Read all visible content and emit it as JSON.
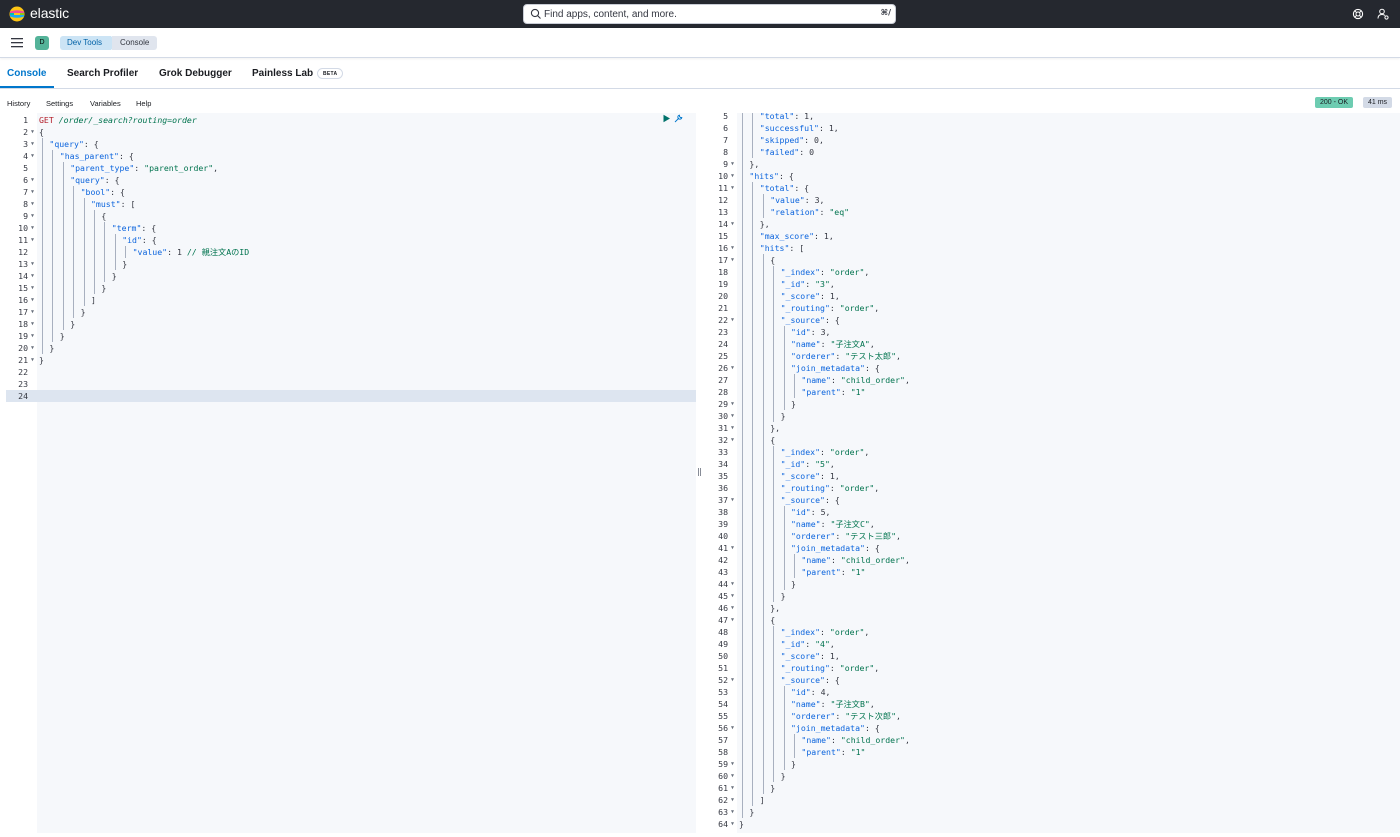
{
  "header": {
    "brand": "elastic",
    "search_placeholder": "Find apps, content, and more.",
    "search_shortcut": "⌘/"
  },
  "breadcrumbs": {
    "space_initial": "D",
    "items": [
      "Dev Tools",
      "Console"
    ]
  },
  "tabs": {
    "items": [
      {
        "label": "Console",
        "active": true
      },
      {
        "label": "Search Profiler",
        "active": false
      },
      {
        "label": "Grok Debugger",
        "active": false
      },
      {
        "label": "Painless Lab",
        "active": false
      }
    ],
    "beta_label": "BETA"
  },
  "toolbar": {
    "items": [
      "History",
      "Settings",
      "Variables",
      "Help"
    ],
    "status": "200 - OK",
    "duration": "41 ms"
  },
  "request_editor": {
    "active_line": 24,
    "lines": [
      {
        "n": "1",
        "fold": false,
        "indent": 0,
        "text": "GET /order/_search?routing=order"
      },
      {
        "n": "2",
        "fold": true,
        "indent": 0,
        "text": "{"
      },
      {
        "n": "3",
        "fold": true,
        "indent": 1,
        "text": "\"query\": {"
      },
      {
        "n": "4",
        "fold": true,
        "indent": 2,
        "text": "\"has_parent\": {"
      },
      {
        "n": "5",
        "fold": false,
        "indent": 3,
        "text": "\"parent_type\": \"parent_order\","
      },
      {
        "n": "6",
        "fold": true,
        "indent": 3,
        "text": "\"query\": {"
      },
      {
        "n": "7",
        "fold": true,
        "indent": 4,
        "text": "\"bool\": {"
      },
      {
        "n": "8",
        "fold": true,
        "indent": 5,
        "text": "\"must\": ["
      },
      {
        "n": "9",
        "fold": true,
        "indent": 6,
        "text": "{"
      },
      {
        "n": "10",
        "fold": true,
        "indent": 7,
        "text": "\"term\": {"
      },
      {
        "n": "11",
        "fold": true,
        "indent": 8,
        "text": "\"id\": {"
      },
      {
        "n": "12",
        "fold": false,
        "indent": 9,
        "text": "\"value\": 1 // 親注文AのID"
      },
      {
        "n": "13",
        "fold": true,
        "indent": 8,
        "text": "}"
      },
      {
        "n": "14",
        "fold": true,
        "indent": 7,
        "text": "}"
      },
      {
        "n": "15",
        "fold": true,
        "indent": 6,
        "text": "}"
      },
      {
        "n": "16",
        "fold": true,
        "indent": 5,
        "text": "]"
      },
      {
        "n": "17",
        "fold": true,
        "indent": 4,
        "text": "}"
      },
      {
        "n": "18",
        "fold": true,
        "indent": 3,
        "text": "}"
      },
      {
        "n": "19",
        "fold": true,
        "indent": 2,
        "text": "}"
      },
      {
        "n": "20",
        "fold": true,
        "indent": 1,
        "text": "}"
      },
      {
        "n": "21",
        "fold": true,
        "indent": 0,
        "text": "}"
      },
      {
        "n": "22",
        "fold": false,
        "indent": 0,
        "text": ""
      },
      {
        "n": "23",
        "fold": false,
        "indent": 0,
        "text": ""
      },
      {
        "n": "24",
        "fold": false,
        "indent": 0,
        "text": ""
      }
    ]
  },
  "response_editor": {
    "lines": [
      {
        "n": "5",
        "fold": false,
        "indent": 2,
        "text": "\"total\": 1,"
      },
      {
        "n": "6",
        "fold": false,
        "indent": 2,
        "text": "\"successful\": 1,"
      },
      {
        "n": "7",
        "fold": false,
        "indent": 2,
        "text": "\"skipped\": 0,"
      },
      {
        "n": "8",
        "fold": false,
        "indent": 2,
        "text": "\"failed\": 0"
      },
      {
        "n": "9",
        "fold": true,
        "indent": 1,
        "text": "},"
      },
      {
        "n": "10",
        "fold": true,
        "indent": 1,
        "text": "\"hits\": {"
      },
      {
        "n": "11",
        "fold": true,
        "indent": 2,
        "text": "\"total\": {"
      },
      {
        "n": "12",
        "fold": false,
        "indent": 3,
        "text": "\"value\": 3,"
      },
      {
        "n": "13",
        "fold": false,
        "indent": 3,
        "text": "\"relation\": \"eq\""
      },
      {
        "n": "14",
        "fold": true,
        "indent": 2,
        "text": "},"
      },
      {
        "n": "15",
        "fold": false,
        "indent": 2,
        "text": "\"max_score\": 1,"
      },
      {
        "n": "16",
        "fold": true,
        "indent": 2,
        "text": "\"hits\": ["
      },
      {
        "n": "17",
        "fold": true,
        "indent": 3,
        "text": "{"
      },
      {
        "n": "18",
        "fold": false,
        "indent": 4,
        "text": "\"_index\": \"order\","
      },
      {
        "n": "19",
        "fold": false,
        "indent": 4,
        "text": "\"_id\": \"3\","
      },
      {
        "n": "20",
        "fold": false,
        "indent": 4,
        "text": "\"_score\": 1,"
      },
      {
        "n": "21",
        "fold": false,
        "indent": 4,
        "text": "\"_routing\": \"order\","
      },
      {
        "n": "22",
        "fold": true,
        "indent": 4,
        "text": "\"_source\": {"
      },
      {
        "n": "23",
        "fold": false,
        "indent": 5,
        "text": "\"id\": 3,"
      },
      {
        "n": "24",
        "fold": false,
        "indent": 5,
        "text": "\"name\": \"子注文A\","
      },
      {
        "n": "25",
        "fold": false,
        "indent": 5,
        "text": "\"orderer\": \"テスト太郎\","
      },
      {
        "n": "26",
        "fold": true,
        "indent": 5,
        "text": "\"join_metadata\": {"
      },
      {
        "n": "27",
        "fold": false,
        "indent": 6,
        "text": "\"name\": \"child_order\","
      },
      {
        "n": "28",
        "fold": false,
        "indent": 6,
        "text": "\"parent\": \"1\""
      },
      {
        "n": "29",
        "fold": true,
        "indent": 5,
        "text": "}"
      },
      {
        "n": "30",
        "fold": true,
        "indent": 4,
        "text": "}"
      },
      {
        "n": "31",
        "fold": true,
        "indent": 3,
        "text": "},"
      },
      {
        "n": "32",
        "fold": true,
        "indent": 3,
        "text": "{"
      },
      {
        "n": "33",
        "fold": false,
        "indent": 4,
        "text": "\"_index\": \"order\","
      },
      {
        "n": "34",
        "fold": false,
        "indent": 4,
        "text": "\"_id\": \"5\","
      },
      {
        "n": "35",
        "fold": false,
        "indent": 4,
        "text": "\"_score\": 1,"
      },
      {
        "n": "36",
        "fold": false,
        "indent": 4,
        "text": "\"_routing\": \"order\","
      },
      {
        "n": "37",
        "fold": true,
        "indent": 4,
        "text": "\"_source\": {"
      },
      {
        "n": "38",
        "fold": false,
        "indent": 5,
        "text": "\"id\": 5,"
      },
      {
        "n": "39",
        "fold": false,
        "indent": 5,
        "text": "\"name\": \"子注文C\","
      },
      {
        "n": "40",
        "fold": false,
        "indent": 5,
        "text": "\"orderer\": \"テスト三郎\","
      },
      {
        "n": "41",
        "fold": true,
        "indent": 5,
        "text": "\"join_metadata\": {"
      },
      {
        "n": "42",
        "fold": false,
        "indent": 6,
        "text": "\"name\": \"child_order\","
      },
      {
        "n": "43",
        "fold": false,
        "indent": 6,
        "text": "\"parent\": \"1\""
      },
      {
        "n": "44",
        "fold": true,
        "indent": 5,
        "text": "}"
      },
      {
        "n": "45",
        "fold": true,
        "indent": 4,
        "text": "}"
      },
      {
        "n": "46",
        "fold": true,
        "indent": 3,
        "text": "},"
      },
      {
        "n": "47",
        "fold": true,
        "indent": 3,
        "text": "{"
      },
      {
        "n": "48",
        "fold": false,
        "indent": 4,
        "text": "\"_index\": \"order\","
      },
      {
        "n": "49",
        "fold": false,
        "indent": 4,
        "text": "\"_id\": \"4\","
      },
      {
        "n": "50",
        "fold": false,
        "indent": 4,
        "text": "\"_score\": 1,"
      },
      {
        "n": "51",
        "fold": false,
        "indent": 4,
        "text": "\"_routing\": \"order\","
      },
      {
        "n": "52",
        "fold": true,
        "indent": 4,
        "text": "\"_source\": {"
      },
      {
        "n": "53",
        "fold": false,
        "indent": 5,
        "text": "\"id\": 4,"
      },
      {
        "n": "54",
        "fold": false,
        "indent": 5,
        "text": "\"name\": \"子注文B\","
      },
      {
        "n": "55",
        "fold": false,
        "indent": 5,
        "text": "\"orderer\": \"テスト次郎\","
      },
      {
        "n": "56",
        "fold": true,
        "indent": 5,
        "text": "\"join_metadata\": {"
      },
      {
        "n": "57",
        "fold": false,
        "indent": 6,
        "text": "\"name\": \"child_order\","
      },
      {
        "n": "58",
        "fold": false,
        "indent": 6,
        "text": "\"parent\": \"1\""
      },
      {
        "n": "59",
        "fold": true,
        "indent": 5,
        "text": "}"
      },
      {
        "n": "60",
        "fold": true,
        "indent": 4,
        "text": "}"
      },
      {
        "n": "61",
        "fold": true,
        "indent": 3,
        "text": "}"
      },
      {
        "n": "62",
        "fold": true,
        "indent": 2,
        "text": "]"
      },
      {
        "n": "63",
        "fold": true,
        "indent": 1,
        "text": "}"
      },
      {
        "n": "64",
        "fold": true,
        "indent": 0,
        "text": "}"
      }
    ]
  },
  "icons": {
    "logo": "elastic-logo-icon",
    "search": "search-icon",
    "help": "help-icon",
    "user": "user-menu-icon",
    "menu": "hamburger-menu-icon",
    "run": "play-icon",
    "wrench": "wrench-icon"
  },
  "colors": {
    "header_bg": "#25282f",
    "accent": "#0077cc",
    "status_ok": "#6dccb1",
    "method": "#b31d28",
    "string": "#00734e",
    "key": "#0b64dd"
  }
}
